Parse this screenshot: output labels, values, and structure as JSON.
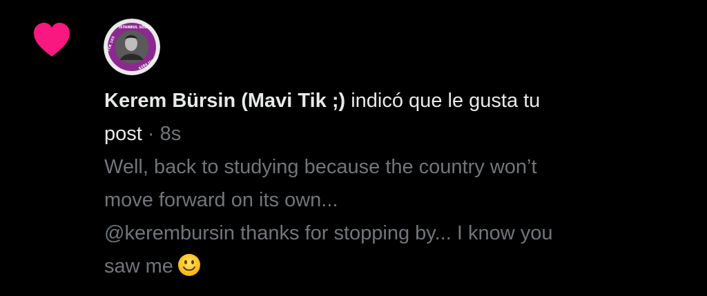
{
  "notification": {
    "user_name": "Kerem Bürsin (Mavi Tik ;)",
    "action_text": " indicó que le gusta tu",
    "action_text_cont": "post",
    "separator": " · ",
    "time": "8s",
    "post": {
      "line1": "Well, back to studying because the country won’t",
      "line2": "move forward on its own...",
      "line3": "@kerembursin thanks for stopping by... I know you",
      "line4": "saw me"
    }
  },
  "avatar": {
    "badge_top_text": "İSTANBUL SÖZLEŞMESİ YAŞATIR",
    "badge_left_text": "TCK 103",
    "badge_right_text": "6284 UYGULA"
  },
  "colors": {
    "background": "#000000",
    "heart": "#f91880",
    "primary_text": "#e7e9ea",
    "secondary_text": "#71767b",
    "avatar_ring": "#8b2a8e"
  },
  "icons": {
    "like": "heart-icon",
    "emoji": "slightly-smiling-face-icon"
  }
}
